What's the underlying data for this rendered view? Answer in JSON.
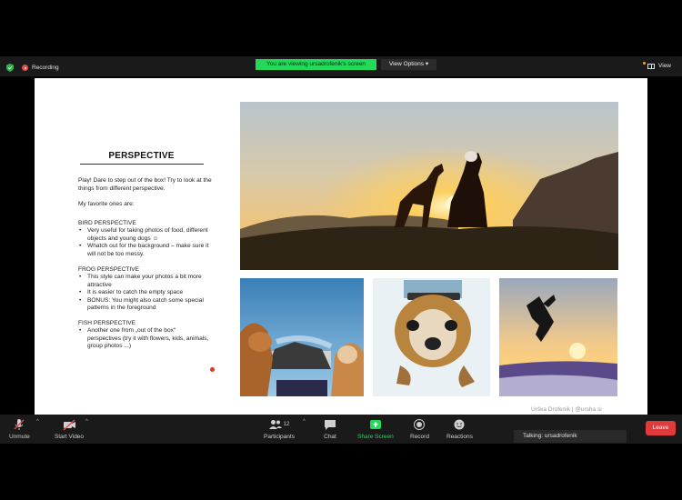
{
  "top_bar": {
    "recording_label": "Recording",
    "viewing_banner": "You are viewing ursadrofenik's screen",
    "view_options_label": "View Options",
    "view_label": "View"
  },
  "slide": {
    "title": "PERSPECTIVE",
    "intro": "Play! Dare to step out of the box! Try to look at the things from different perspective.",
    "favorites": "My favorite ones are:",
    "sections": [
      {
        "heading": "BIRD PERSPECTIVE",
        "items": [
          "Very useful for taking photos of food, different objects and young dogs ☺",
          "Whatch out for the background – make sure it will not be too messy."
        ]
      },
      {
        "heading": "FROG PERSPECTIVE",
        "items": [
          "This style can make your photos a bit more attractive",
          "It is easier to catch the empty space",
          "BONUS: You might also catch some special patterns in the foreground"
        ]
      },
      {
        "heading": "FISH PERSPECTIVE",
        "items": [
          "Another one from „out of the box“ perspectives (try it with flowers, kids, animals, group photos ...)"
        ]
      }
    ],
    "credit": "Urška Drofenik  |  @ursha.si"
  },
  "toolbar": {
    "unmute": "Unmute",
    "start_video": "Start Video",
    "participants": "Participants",
    "participants_count": "12",
    "chat": "Chat",
    "share_screen": "Share Screen",
    "record": "Record",
    "reactions": "Reactions",
    "leave": "Leave",
    "talking": "Talking: ursadrofenik"
  },
  "colors": {
    "banner_green": "#23d959",
    "leave_red": "#e03a3a",
    "share_green": "#23d959"
  }
}
